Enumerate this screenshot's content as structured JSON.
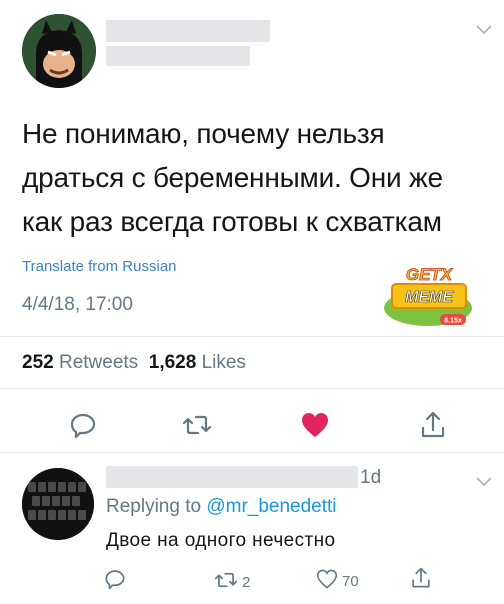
{
  "tweet": {
    "text": "Не понимаю, почему нельзя\nдраться с беременными. Они же\nкак раз всегда готовы к схваткам",
    "translate_label": "Translate from Russian",
    "timestamp": "4/4/18, 17:00"
  },
  "watermark": {
    "line1": "GETX",
    "line2": "MEME",
    "badge": "8.15x"
  },
  "stats": {
    "retweets_count": "252",
    "retweets_label": "Retweets",
    "likes_count": "1,628",
    "likes_label": "Likes"
  },
  "reply": {
    "time": "1d",
    "replying_prefix": "Replying to",
    "replying_handle": "@mr_benedetti",
    "text": "Двое на одного нечестно",
    "retweet_count": "2",
    "like_count": "70"
  },
  "icons": {
    "reply": "reply-icon",
    "retweet": "retweet-icon",
    "like": "heart-icon",
    "share": "share-icon",
    "more": "chevron-down-icon"
  },
  "colors": {
    "like_active": "#e0245e",
    "link": "#1b95e0",
    "muted": "#657786"
  }
}
